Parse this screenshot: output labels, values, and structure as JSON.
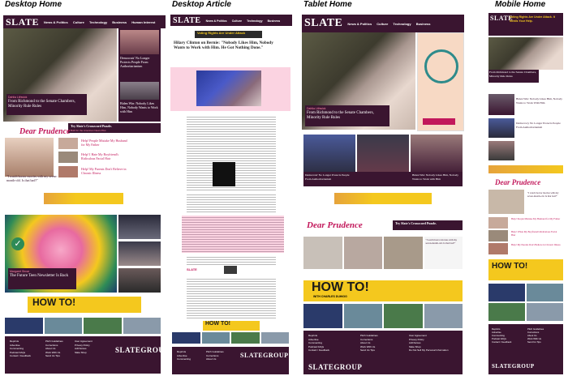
{
  "columns": {
    "desktop_home": "Desktop Home",
    "desktop_article": "Desktop Article",
    "tablet_home": "Tablet Home",
    "mobile_home": "Mobile Home"
  },
  "nav": {
    "logo": "SLATE",
    "news": "News & Politics",
    "culture": "Culture",
    "technology": "Technology",
    "business": "Business",
    "human_interest": "Human Interest"
  },
  "hero": {
    "kicker": "Dahlia Lithwick",
    "headline": "From Richmond to the Senate Chambers, Minority Rule Rules",
    "side1": "Democrats' No Longer Protects People From Authoritarianism",
    "side2": "Biden Win: Nobody Likes Him, Nobody Wants to Work with Him"
  },
  "puzzle": {
    "title": "Try Slate's Crossword Puzzle.",
    "sub": "Built for the American News Pilot"
  },
  "prudence": {
    "title": "Dear Prudence",
    "q1": "Help! People Mistake My Husband for My Father",
    "q2": "Help! I Hate My Boyfriend's Ridiculous Facial Hair",
    "q3": "Help! My Parents Don't Believe in Chronic Illness",
    "quote": "\"I watch horror movies with my seven-month-old. Is that bad?\""
  },
  "newsletter": {
    "kicker": "Margaret Sircar",
    "headline": "The Future Teen Newsletter Is Back"
  },
  "article": {
    "banner": "Voting Rights Are Under Attack",
    "title": "Hilary Clinton on Bernie: \"Nobody Likes Him, Nobody Wants to Work with Him. He Got Nothing Done.\"",
    "byline": "Matt Kenny"
  },
  "howto": {
    "title": "HOW TO!",
    "sub": "WITH CHARLES DUHIGG"
  },
  "mobile": {
    "banner": "Voting Rights Are Under Attack. It Needs Your Help.",
    "head1": "From Richmond to the Senate Chambers, Minority Rule Rules",
    "head2": "Democracy No Longer Protects People From Authoritarianism",
    "head3": "Biden Win: Nobody Likes Him, Nobody Wants to Work With Him",
    "head4": "Try Slate's Crossword Puzzle"
  },
  "footer": {
    "c1": [
      "Reprints",
      "Advertise",
      "Commenting",
      "Podcast FAQs",
      "Contact / Feedback"
    ],
    "c2": [
      "Pitch Guidelines",
      "Corrections",
      "About Us",
      "Work With Us",
      "Send Us Tips"
    ],
    "c3": [
      "User Agreement",
      "Privacy Policy",
      "AdChoices",
      "Slate Shop",
      "Do Not Sell My Personal Information"
    ],
    "group": "SLATEGROUP"
  }
}
